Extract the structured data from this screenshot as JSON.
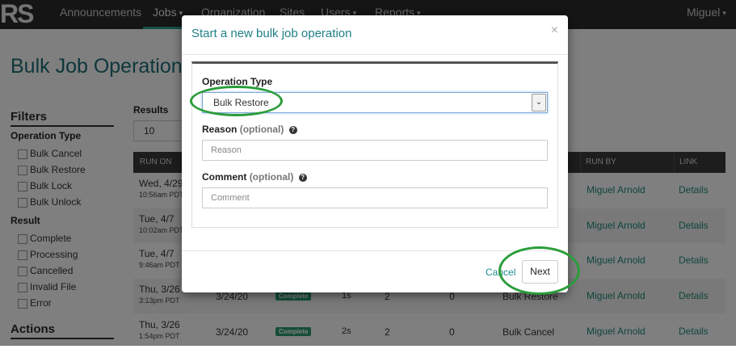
{
  "nav": {
    "logo": "RS",
    "items": [
      {
        "label": "Announcements",
        "caret": ""
      },
      {
        "label": "Jobs",
        "caret": "▾"
      },
      {
        "label": "Organization",
        "caret": ""
      },
      {
        "label": "Sites",
        "caret": ""
      },
      {
        "label": "Users",
        "caret": "▾"
      },
      {
        "label": "Reports",
        "caret": "▾"
      }
    ],
    "user": "Miguel",
    "user_caret": "▾"
  },
  "page": {
    "title": "Bulk Job Operations",
    "filters_title": "Filters",
    "operation_type_title": "Operation Type",
    "operation_types": [
      "Bulk Cancel",
      "Bulk Restore",
      "Bulk Lock",
      "Bulk Unlock"
    ],
    "result_title": "Result",
    "results_options": [
      "Complete",
      "Processing",
      "Cancelled",
      "Invalid File",
      "Error"
    ],
    "actions_title": "Actions",
    "results_label": "Results",
    "results_value": "10"
  },
  "table": {
    "headers": {
      "run_on": "RUN ON",
      "run_by": "RUN BY",
      "link": "LINK"
    },
    "rows": [
      {
        "date": "Wed, 4/29",
        "time": "10:56am PDT",
        "run_by": "Miguel Arnold",
        "link": "Details"
      },
      {
        "date": "Tue, 4/7",
        "time": "10:02am PDT",
        "run_by": "Miguel Arnold",
        "link": "Details"
      },
      {
        "date": "Tue, 4/7",
        "time": "9:46am PDT",
        "run_by": "Miguel Arnold",
        "link": "Details"
      },
      {
        "date": "Thu, 3/26",
        "time": "3:13pm PDT",
        "filed": "3/24/20",
        "status": "Complete",
        "duration": "1s",
        "count": "2",
        "errors": "0",
        "operation": "Bulk Restore",
        "run_by": "Miguel Arnold",
        "link": "Details"
      },
      {
        "date": "Thu, 3/26",
        "time": "1:54pm PDT",
        "filed": "3/24/20",
        "status": "Complete",
        "duration": "2s",
        "count": "2",
        "errors": "0",
        "operation": "Bulk Cancel",
        "run_by": "Miguel Arnold",
        "link": "Details"
      }
    ]
  },
  "modal": {
    "title": "Start a new bulk job operation",
    "close": "×",
    "operation_type_label": "Operation Type",
    "operation_type_value": "Bulk Restore",
    "reason_label": "Reason",
    "reason_optional": "(optional)",
    "reason_placeholder": "Reason",
    "comment_label": "Comment",
    "comment_optional": "(optional)",
    "comment_placeholder": "Comment",
    "help": "?",
    "cancel_label": "Cancel",
    "next_label": "Next"
  },
  "colors": {
    "accent": "#1f7f85",
    "annotation": "#2a9d3a",
    "nav_bg": "#2a2a2a",
    "status_badge": "#2a9d6f"
  }
}
